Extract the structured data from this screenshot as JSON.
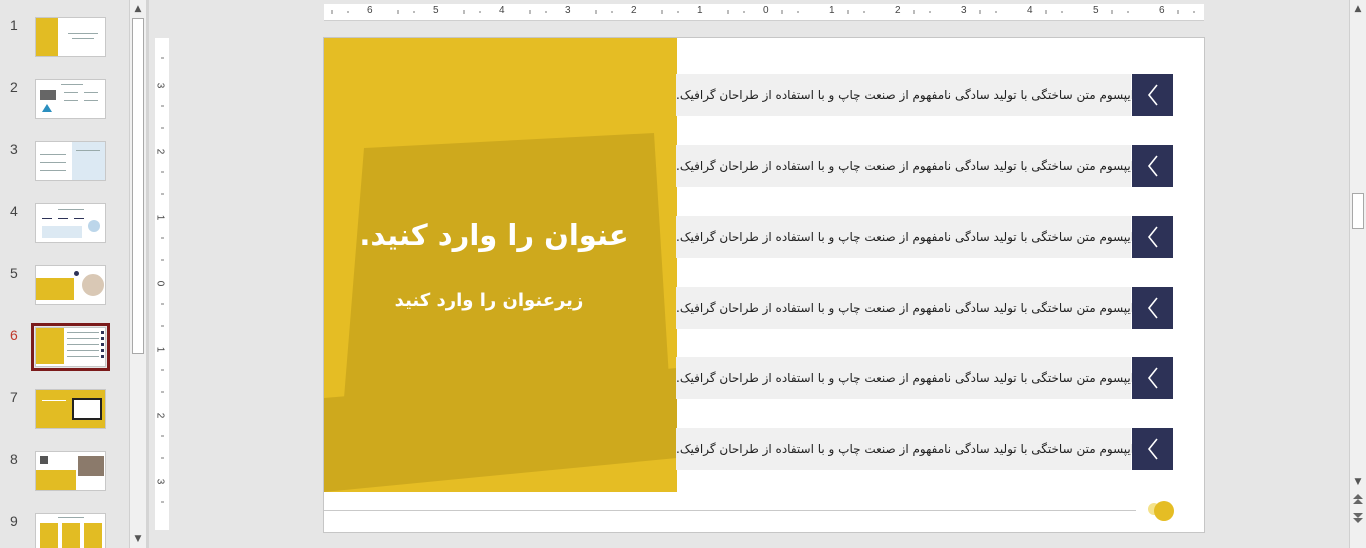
{
  "thumbnails": [
    {
      "num": "1"
    },
    {
      "num": "2"
    },
    {
      "num": "3"
    },
    {
      "num": "4"
    },
    {
      "num": "5"
    },
    {
      "num": "6"
    },
    {
      "num": "7"
    },
    {
      "num": "8"
    },
    {
      "num": "9"
    }
  ],
  "selected_slide": "6",
  "ruler": {
    "horizontal": [
      "6",
      "5",
      "4",
      "3",
      "2",
      "1",
      "0",
      "1",
      "2",
      "3",
      "4",
      "5",
      "6"
    ],
    "vertical": [
      "3",
      "2",
      "1",
      "0",
      "1",
      "2",
      "3"
    ]
  },
  "slide": {
    "title": "عنوان را وارد کنید.",
    "subtitle": "زیرعنوان را وارد کنید",
    "items": [
      {
        "text": "لورم ایپسوم متن ساختگی با تولید سادگی نامفهوم از صنعت چاپ و با استفاده از طراحان گرافیک."
      },
      {
        "text": "لورم ایپسوم متن ساختگی با تولید سادگی نامفهوم از صنعت چاپ و با استفاده از طراحان گرافیک."
      },
      {
        "text": "لورم ایپسوم متن ساختگی با تولید سادگی نامفهوم از صنعت چاپ و با استفاده از طراحان گرافیک."
      },
      {
        "text": "لورم ایپسوم متن ساختگی با تولید سادگی نامفهوم از صنعت چاپ و با استفاده از طراحان گرافیک."
      },
      {
        "text": "لورم ایپسوم متن ساختگی با تولید سادگی نامفهوم از صنعت چاپ و با استفاده از طراحان گرافیک."
      },
      {
        "text": "لورم ایپسوم متن ساختگی با تولید سادگی نامفهوم از صنعت چاپ و با استفاده از طراحان گرافیک."
      }
    ]
  },
  "colors": {
    "accent_yellow": "#e5bd24",
    "navy": "#2d3257",
    "selection": "#7b1b1b"
  },
  "icons": {
    "bullet_icon": "chevron-left-icon",
    "scroll_up": "scroll-up-arrow-icon",
    "scroll_down": "scroll-down-arrow-icon",
    "prev_slide": "previous-slide-icon",
    "next_slide": "next-slide-icon"
  }
}
